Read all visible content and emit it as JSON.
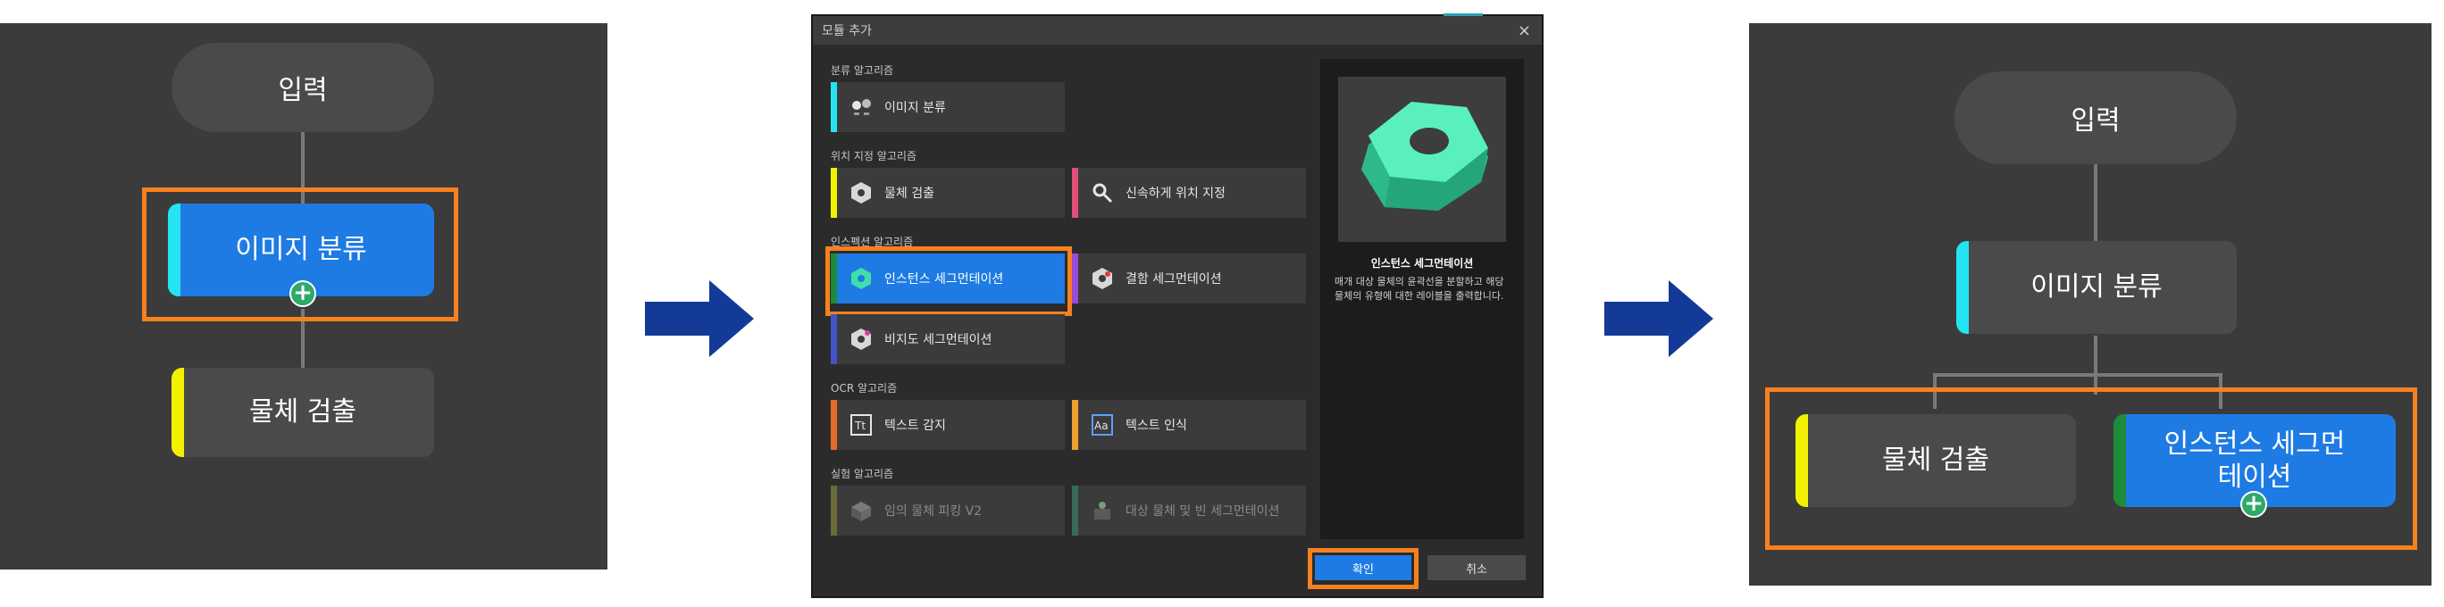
{
  "panel_left": {
    "input_label": "입력",
    "node_classify": "이미지 분류",
    "node_detect": "물체 검출"
  },
  "dialog": {
    "title": "모듈 추가",
    "close_glyph": "×",
    "sections": {
      "classification": "분류 알고리즘",
      "location": "위치 지정 알고리즘",
      "instance": "인스펙션 알고리즘",
      "ocr": "OCR 알고리즘",
      "synthetic": "실험 알고리즘"
    },
    "cards": {
      "image_classify": "이미지 분류",
      "object_detect": "물체 검출",
      "fast_locate": "신속하게 위치 지정",
      "instance_seg": "인스턴스 세그먼테이션",
      "defect_seg": "결함 세그먼테이션",
      "unsup_seg": "비지도 세그먼테이션",
      "text_detect": "텍스트 감지",
      "text_recog": "텍스트 인식",
      "pick_v2": "임의 물체 피킹 V2",
      "target_bin_seg": "대상 물체 및 빈 세그먼테이션"
    },
    "preview": {
      "title": "인스턴스 세그먼테이션",
      "description": "매개 대상 물체의 윤곽선을 분할하고 해당 물체의 유형에 대한 레이블을 출력합니다."
    },
    "ok_label": "확인",
    "cancel_label": "취소"
  },
  "panel_right": {
    "input_label": "입력",
    "node_classify": "이미지 분류",
    "node_detect": "물체 검출",
    "node_instance_line1": "인스턴스 세그먼",
    "node_instance_line2": "테이션"
  },
  "colors": {
    "panel_bg": "#3b3b3b",
    "node_bg": "#4a4a4a",
    "selected_blue": "#1e7be3",
    "highlight_orange": "#f7801f",
    "arrow_blue": "#133a96",
    "bar_cyan": "#24e4f2",
    "bar_yellow": "#f2f200",
    "bar_green": "#1f8a3a",
    "bar_pink": "#e0507a",
    "bar_purple": "#9a4ad6",
    "bar_indigo": "#4454c8",
    "bar_orange": "#e86a2a",
    "bar_amber": "#f0a030",
    "bar_olive": "#6a6a3a",
    "bar_teal": "#3a6a5a"
  }
}
